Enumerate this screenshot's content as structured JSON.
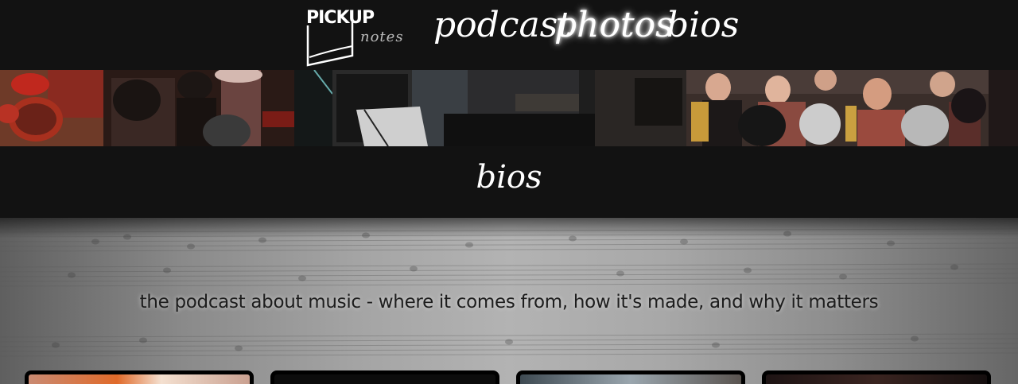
{
  "brand": {
    "logo_word": "PICKUP",
    "logo_sub": "notes"
  },
  "nav": {
    "items": [
      {
        "label": "podcast",
        "active": false
      },
      {
        "label": "photos",
        "active": true
      },
      {
        "label": "bios",
        "active": false
      }
    ]
  },
  "section": {
    "title": "bios"
  },
  "hero": {
    "tagline": "the podcast about music - where it comes from, how it's made, and why it matters"
  },
  "colors": {
    "bar_background": "#121212",
    "text": "#ffffff",
    "tagline_text": "#1d1d1d"
  }
}
